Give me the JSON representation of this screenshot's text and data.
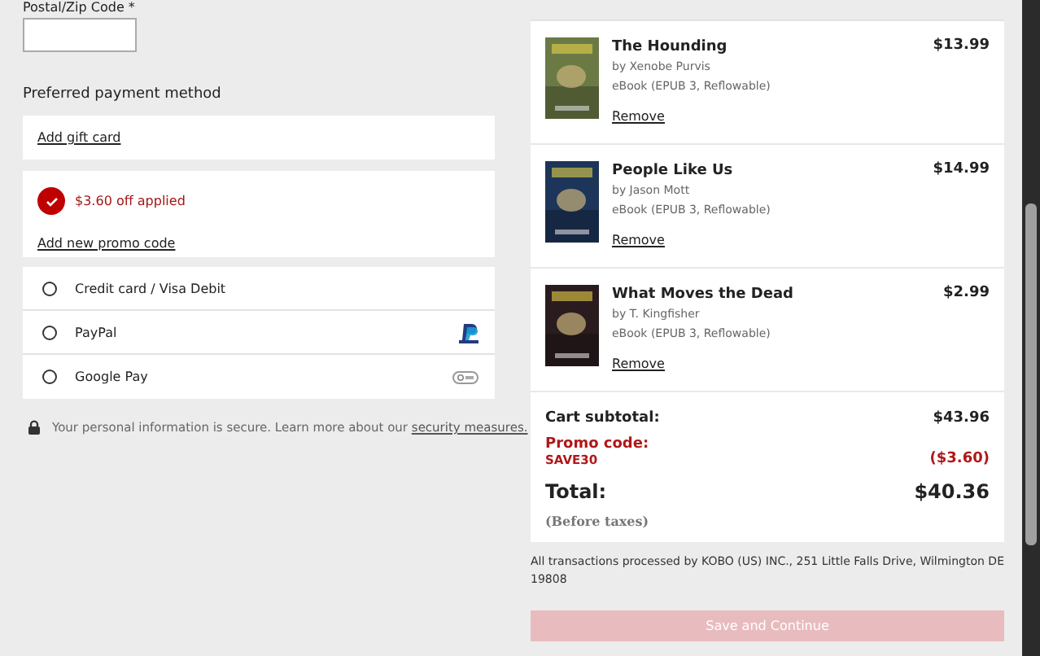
{
  "postal_field": {
    "label": "Postal/Zip Code *"
  },
  "payment": {
    "title": "Preferred payment method",
    "gift_card_link": "Add gift card",
    "promo": {
      "applied": true,
      "message": "$3.60 off applied",
      "link": "Add new promo code"
    },
    "methods": [
      {
        "label": "Credit card / Visa Debit",
        "selected": false,
        "kind": "card"
      },
      {
        "label": "PayPal",
        "selected": false,
        "kind": "paypal"
      },
      {
        "label": "Google Pay",
        "selected": false,
        "kind": "gpay"
      }
    ],
    "security_note": {
      "text": "Your personal information is secure. Learn more about our ",
      "link": "security measures."
    }
  },
  "cart": {
    "items": [
      {
        "title": "The Hounding",
        "author": "by Xenobe Purvis",
        "format": "eBook (EPUB 3, Reflowable)",
        "remove": "Remove",
        "price": "$13.99"
      },
      {
        "title": "People Like Us",
        "author": "by Jason Mott",
        "format": "eBook (EPUB 3, Reflowable)",
        "remove": "Remove",
        "price": "$14.99"
      },
      {
        "title": "What Moves the Dead",
        "author": "by T. Kingfisher",
        "format": "eBook (EPUB 3, Reflowable)",
        "remove": "Remove",
        "price": "$2.99"
      }
    ],
    "subtotal": {
      "label": "Cart subtotal:",
      "value": "$43.96"
    },
    "promo": {
      "label": "Promo code:",
      "code": "SAVE30",
      "value": "($3.60)"
    },
    "total": {
      "label": "Total:",
      "value": "$40.36"
    },
    "tax_note": "(Before taxes)",
    "legal": "All transactions processed by KOBO (US) INC., 251 Little Falls Drive, Wilmington DE 19808",
    "button": {
      "label": "Save and Continue",
      "disabled": true
    }
  }
}
